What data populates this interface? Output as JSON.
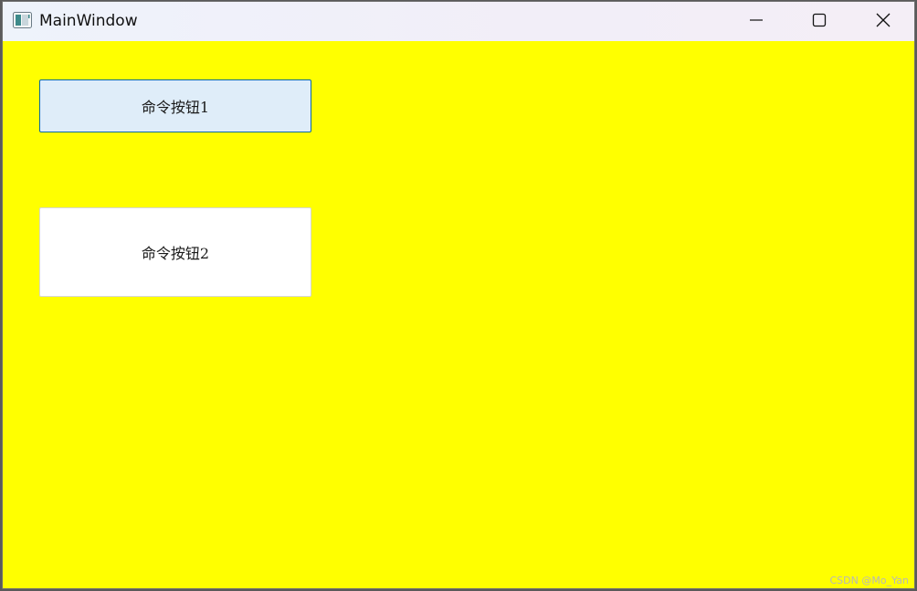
{
  "window": {
    "title": "MainWindow",
    "icon": "app-window-icon",
    "background_color": "#ffff00"
  },
  "title_controls": {
    "minimize_icon": "minimize-icon",
    "maximize_icon": "maximize-icon",
    "close_icon": "close-icon"
  },
  "buttons": [
    {
      "label": "命令按钮1",
      "background": "#dfedf9",
      "border": "#0a6aa6"
    },
    {
      "label": "命令按钮2",
      "background": "#ffffff",
      "border": "#d6d6d6"
    }
  ],
  "watermark": "CSDN @Mo_Yan"
}
